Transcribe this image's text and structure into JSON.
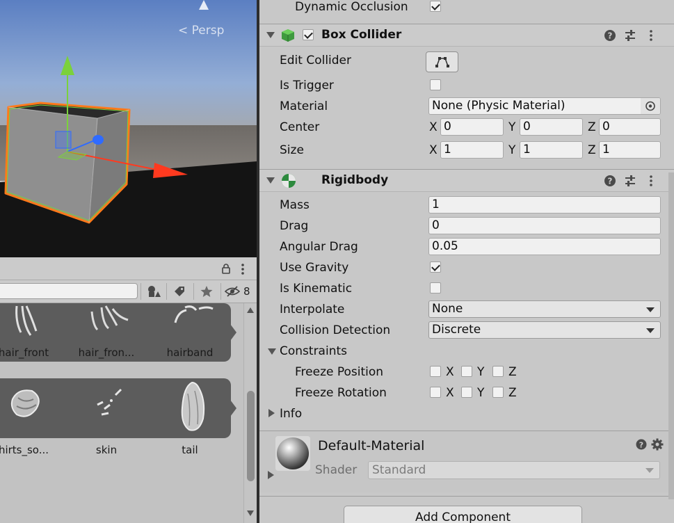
{
  "scene": {
    "persp_label": "Persp"
  },
  "project": {
    "hidden_count": "8",
    "rows": [
      {
        "labels": [
          "hair_front",
          "hair_fron...",
          "hairband"
        ]
      },
      {
        "labels": [
          "hirts_so...",
          "skin",
          "tail"
        ]
      }
    ]
  },
  "inspector": {
    "dynamic_occlusion": {
      "label": "Dynamic Occlusion",
      "checked": true
    },
    "box_collider": {
      "title": "Box Collider",
      "enabled": true,
      "edit_collider_label": "Edit Collider",
      "is_trigger_label": "Is Trigger",
      "material_label": "Material",
      "material_value": "None (Physic Material)",
      "center_label": "Center",
      "center": {
        "x": "0",
        "y": "0",
        "z": "0"
      },
      "size_label": "Size",
      "size": {
        "x": "1",
        "y": "1",
        "z": "1"
      },
      "axis_x": "X",
      "axis_y": "Y",
      "axis_z": "Z"
    },
    "rigidbody": {
      "title": "Rigidbody",
      "mass_label": "Mass",
      "mass": "1",
      "drag_label": "Drag",
      "drag": "0",
      "angular_drag_label": "Angular Drag",
      "angular_drag": "0.05",
      "use_gravity_label": "Use Gravity",
      "use_gravity": true,
      "is_kinematic_label": "Is Kinematic",
      "is_kinematic": false,
      "interpolate_label": "Interpolate",
      "interpolate": "None",
      "collision_detection_label": "Collision Detection",
      "collision_detection": "Discrete",
      "constraints_label": "Constraints",
      "freeze_position_label": "Freeze Position",
      "freeze_rotation_label": "Freeze Rotation",
      "info_label": "Info"
    },
    "material": {
      "name": "Default-Material",
      "shader_label": "Shader",
      "shader_value": "Standard"
    },
    "add_component_label": "Add Component"
  },
  "colors": {
    "scene_sky": "#7f9fd2",
    "selection_outline": "#ff7a1a",
    "gizmo_x": "#ff3a1f",
    "gizmo_y": "#7bd13c",
    "gizmo_z": "#2f6bff"
  }
}
